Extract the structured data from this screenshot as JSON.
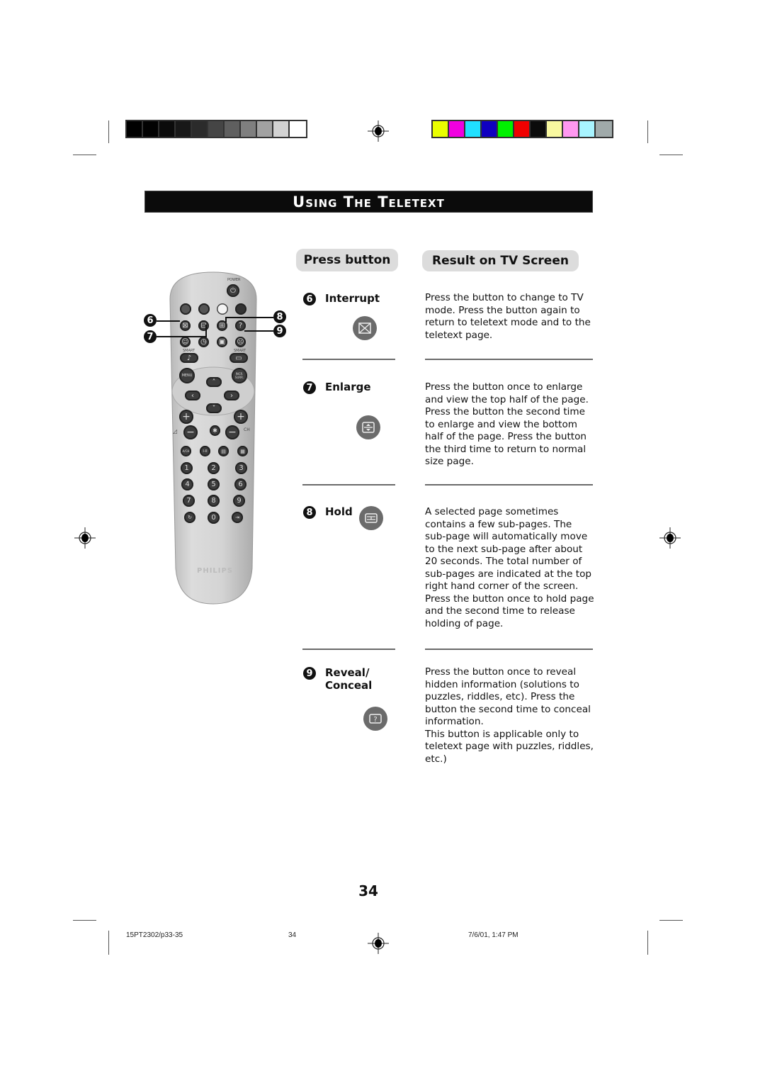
{
  "calibration": {
    "grayscale": [
      "#000000",
      "#020202",
      "#0b0b0b",
      "#181818",
      "#2b2b2b",
      "#454545",
      "#5f5f5f",
      "#7f7f7f",
      "#a2a2a2",
      "#d2d2d2",
      "#ffffff"
    ],
    "colors": [
      "#eaff00",
      "#f000e0",
      "#20e0ff",
      "#1000c0",
      "#00f000",
      "#f00000",
      "#0b0b0b",
      "#f8f8a0",
      "#ff98f0",
      "#a8f4ff",
      "#a0aaaa"
    ]
  },
  "header": {
    "title": "Using The Teletext"
  },
  "columns": {
    "press_button": "Press button",
    "result": "Result on TV Screen"
  },
  "items": [
    {
      "number": "6",
      "name": "Interrupt",
      "icon": "interrupt-icon",
      "description": "Press the button to change to TV mode. Press the button again to return to teletext mode and to the teletext page."
    },
    {
      "number": "7",
      "name": "Enlarge",
      "icon": "enlarge-icon",
      "description": "Press the button once to enlarge and view the top half of the page. Press the button the second time to enlarge and view the bottom half of the page. Press the button the third time to return to normal size page."
    },
    {
      "number": "8",
      "name": "Hold",
      "icon": "hold-icon",
      "description": "A selected page sometimes contains a few sub-pages. The sub-page will automatically move to the next sub-page after about 20 seconds. The total number of sub-pages are indicated at the top right hand corner of the screen. Press the button once to hold page and the second time to release holding of page."
    },
    {
      "number": "9",
      "name_line1": "Reveal/",
      "name_line2": "Conceal",
      "icon": "reveal-icon",
      "description_line1": "Press the button once to reveal hidden information (solutions to puzzles, riddles, etc). Press the button the second time to conceal information.",
      "description_line2": "This button is applicable only to teletext page with puzzles, riddles, etc.)"
    }
  ],
  "remote": {
    "brand": "PHILIPS",
    "power_label": "POWER",
    "smart_left": "SMART",
    "smart_right": "SMART",
    "menu": "MENU",
    "incr_surr": "INCR. SURR.",
    "ch_label": "CH",
    "av_ch": "A/CH",
    "digits": [
      "1",
      "2",
      "3",
      "4",
      "5",
      "6",
      "7",
      "8",
      "9",
      "0"
    ],
    "callouts": [
      "6",
      "7",
      "8",
      "9"
    ]
  },
  "page_number": "34",
  "footer": {
    "file": "15PT2302/p33-35",
    "page": "34",
    "datetime": "7/6/01, 1:47 PM"
  }
}
